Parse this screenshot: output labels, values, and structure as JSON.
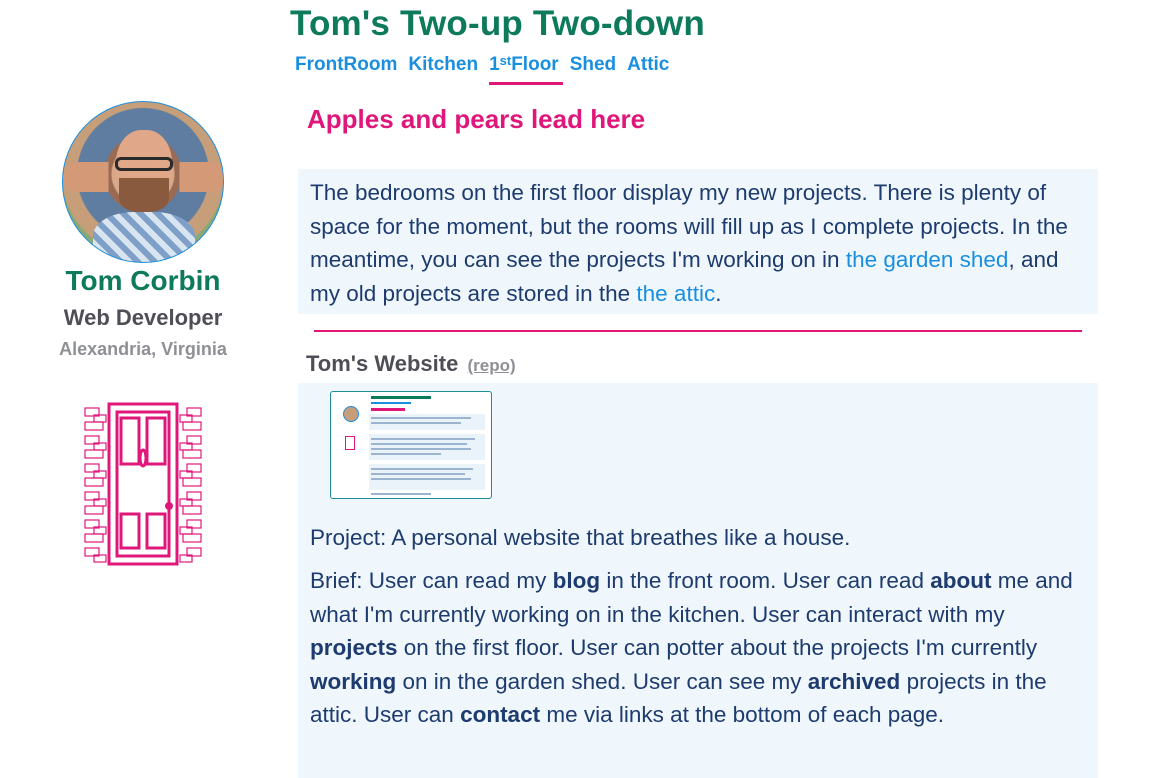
{
  "header": {
    "site_title": "Tom's Two-up Two-down",
    "nav": [
      {
        "label": "FrontRoom"
      },
      {
        "label": "Kitchen"
      },
      {
        "label_prefix": "1",
        "label_sup": "st",
        "label_suffix": "Floor",
        "active": true
      },
      {
        "label": "Shed"
      },
      {
        "label": "Attic"
      }
    ]
  },
  "sidebar": {
    "name": "Tom Corbin",
    "role": "Web Developer",
    "location": "Alexandria, Virginia"
  },
  "main": {
    "tagline": "Apples and pears lead here",
    "intro": {
      "text_1": "The bedrooms on the first floor display my new projects. There is plenty of space for the moment, but the rooms will fill up as I complete projects. In the meantime, you can see the projects I'm working on in ",
      "link_shed": "the garden shed",
      "text_2": ", and my old projects are stored in the ",
      "link_attic": "the attic",
      "text_3": "."
    },
    "project": {
      "title": "Tom's Website",
      "repo_label": "(repo)",
      "description": "Project: A personal website that breathes like a house.",
      "brief": [
        {
          "text": "Brief: User can read my "
        },
        {
          "bold": "blog"
        },
        {
          "text": " in the front room. User can read "
        },
        {
          "bold": "about"
        },
        {
          "text": " me and what I'm currently working on in the kitchen. User can interact with my "
        },
        {
          "bold": "projects"
        },
        {
          "text": " on the first floor. User can potter about the projects I'm currently "
        },
        {
          "bold": "working"
        },
        {
          "text": " on in the garden shed. User can see my "
        },
        {
          "bold": "archived"
        },
        {
          "text": " projects in the attic. User can "
        },
        {
          "bold": "contact"
        },
        {
          "text": " me via links at the bottom of each page."
        }
      ]
    }
  },
  "colors": {
    "title_green": "#0e7a5c",
    "nav_blue": "#1a8fe0",
    "accent_pink": "#e0177a",
    "panel_bg": "#f0f7fc",
    "body_text": "#1d3b6e"
  },
  "icons": {
    "avatar": "profile-photo",
    "door": "front-door-icon"
  }
}
